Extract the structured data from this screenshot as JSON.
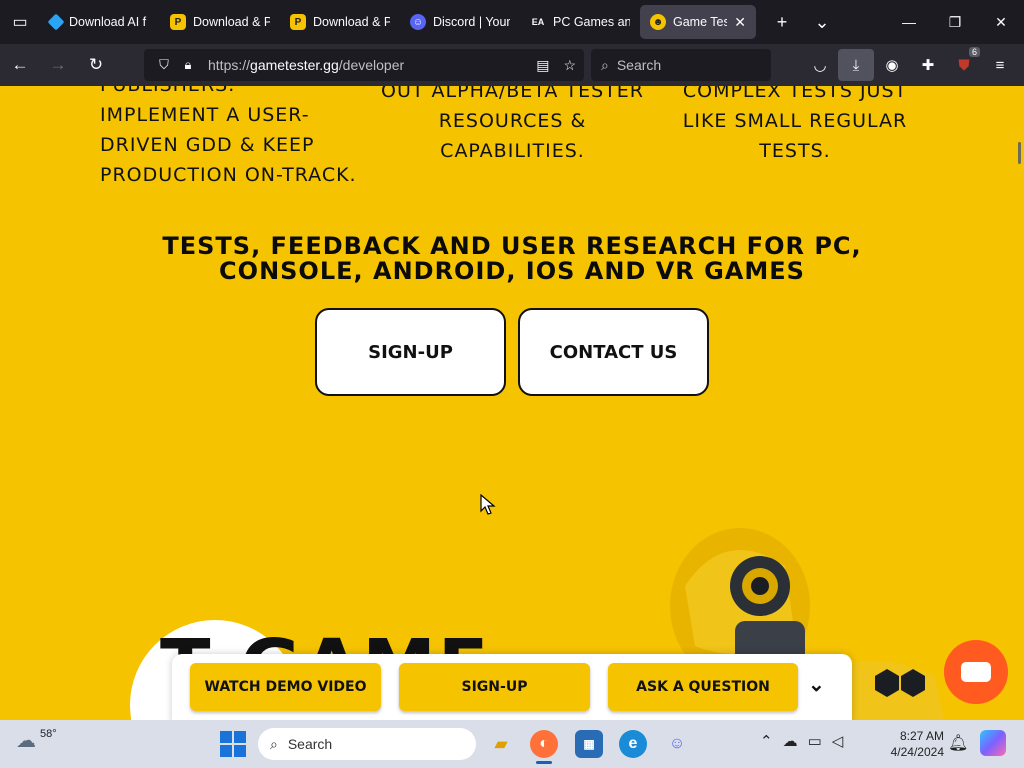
{
  "browser": {
    "tabs": [
      {
        "title": "Download AI f",
        "favicon_color": "#2aa4f4",
        "favicon": "diamond"
      },
      {
        "title": "Download & P",
        "favicon_color": "#f5c300",
        "favicon": "P"
      },
      {
        "title": "Download & P",
        "favicon_color": "#f5c300",
        "favicon": "P"
      },
      {
        "title": "Discord | Your",
        "favicon_color": "#5865f2",
        "favicon": "discord"
      },
      {
        "title": "PC Games and",
        "favicon_color": "#1c1b22",
        "favicon": "EA"
      },
      {
        "title": "Game Teste",
        "favicon_color": "#f5c300",
        "favicon": "GT",
        "active": true
      }
    ],
    "url_prefix": "https://",
    "url_host": "gametester.gg",
    "url_path": "/developer",
    "search_placeholder": "Search",
    "extension_badge": "6"
  },
  "page": {
    "feature_cols": [
      "PUBLISHERS. IMPLEMENT A USER-DRIVEN GDD & KEEP PRODUCTION ON-TRACK.",
      "OUT ALPHA/BETA TESTER RESOURCES & CAPABILITIES.",
      "COMPLEX TESTS JUST LIKE SMALL REGULAR TESTS."
    ],
    "headline": "TESTS, FEEDBACK AND USER RESEARCH FOR PC, CONSOLE, ANDROID, IOS AND VR GAMES",
    "signup_label": "SIGN-UP",
    "contact_label": "CONTACT US",
    "big_text": "T  GAME",
    "sticky_bar": {
      "watch_demo": "WATCH DEMO VIDEO",
      "signup": "SIGN-UP",
      "ask_question": "ASK A QUESTION"
    }
  },
  "taskbar": {
    "weather_temp": "58°",
    "search_placeholder": "Search",
    "time": "8:27 AM",
    "date": "4/24/2024"
  },
  "colors": {
    "brand_yellow": "#f5c300",
    "chat_orange": "#ff5a1f"
  }
}
